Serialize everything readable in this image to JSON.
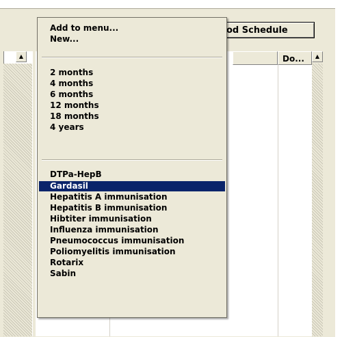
{
  "toolbar": {
    "schedule_button_label": "od Schedule"
  },
  "table": {
    "headers": [
      "",
      "Do..."
    ]
  },
  "icons": {
    "scroll_up": "triangle-up"
  },
  "menu": {
    "actions": [
      "Add to menu...",
      "New..."
    ],
    "ages": [
      "2 months",
      "4 months",
      "6 months",
      "12 months",
      "18 months",
      "4 years"
    ],
    "vaccines": [
      "DTPa-HepB",
      "Gardasil",
      "Hepatitis A immunisation",
      "Hepatitis B immunisation",
      "Hibtiter immunisation",
      "Influenza immunisation",
      "Pneumococcus immunisation",
      "Poliomyelitis immunisation",
      "Rotarix",
      "Sabin"
    ],
    "selected": "Gardasil",
    "selected_color": "#0a246a"
  }
}
